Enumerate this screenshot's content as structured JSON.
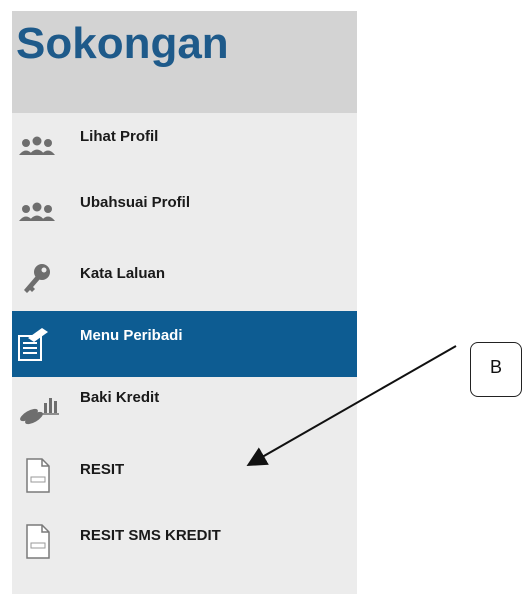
{
  "sidebar": {
    "title": "Sokongan",
    "items": [
      {
        "label": "Lihat Profil",
        "icon": "users-icon",
        "active": false
      },
      {
        "label": "Ubahsuai Profil",
        "icon": "users-icon",
        "active": false
      },
      {
        "label": "Kata Laluan",
        "icon": "key-icon",
        "active": false
      },
      {
        "label": "Menu Peribadi",
        "icon": "document-edit-icon",
        "active": true
      },
      {
        "label": "Baki Kredit",
        "icon": "coins-chart-icon",
        "active": false
      },
      {
        "label": "RESIT",
        "icon": "document-icon",
        "active": false
      },
      {
        "label": "RESIT SMS KREDIT",
        "icon": "document-icon",
        "active": false
      }
    ]
  },
  "annotation": {
    "label": "B"
  },
  "colors": {
    "title": "#1e5a8a",
    "active_bg": "#0d5c92",
    "sidebar_bg": "#ececec",
    "header_bg": "#d3d3d3"
  }
}
